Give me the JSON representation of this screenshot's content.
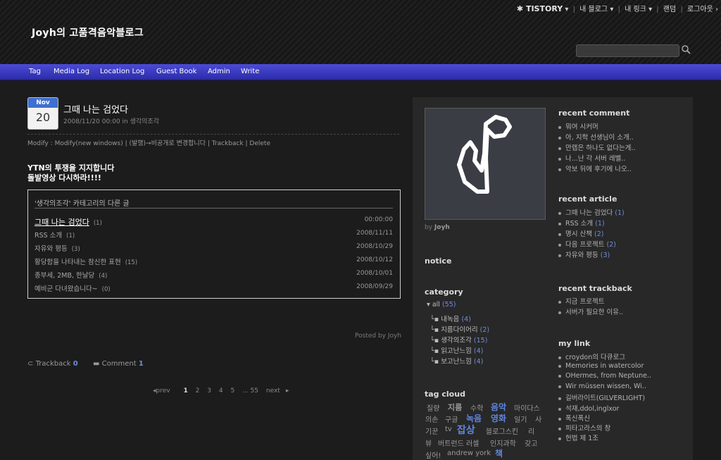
{
  "topbar": {
    "tistory": "TISTORY",
    "my_blog": "내 블로그",
    "my_link": "내 링크",
    "random": "랜덤",
    "logout": "로그아웃"
  },
  "blog_title": "Joyh의 고품격음악블로그",
  "nav": [
    "Tag",
    "Media Log",
    "Location Log",
    "Guest Book",
    "Admin",
    "Write"
  ],
  "post": {
    "month": "Nov",
    "day": "20",
    "title": "그때 나는 검었다",
    "meta": "2008/11/20 00:00 in 생각의조각",
    "modify": "Modify : Modify(new windows) | (발행)→비공개로 변경합니다 | Trackback | Delete",
    "ytn_line1": "YTN의 투쟁을 지지합니다",
    "ytn_line2": "돌발영상 다시하라!!!!",
    "related_title": "'생각의조각' 카테고리의 다른 글",
    "related": [
      {
        "title": "그때 나는 검었다",
        "count": "(1)",
        "date": "00:00:00"
      },
      {
        "title": "RSS 소개",
        "count": "(1)",
        "date": "2008/11/11"
      },
      {
        "title": "자유와 평등",
        "count": "(3)",
        "date": "2008/10/29"
      },
      {
        "title": "황당함을 나타내는 참신한 표현",
        "count": "(15)",
        "date": "2008/10/12"
      },
      {
        "title": "종부세, 2MB, 한날당",
        "count": "(4)",
        "date": "2008/10/01"
      },
      {
        "title": "예비군 다녀왔습니다~",
        "count": "(0)",
        "date": "2008/09/29"
      }
    ],
    "posted_by": "Posted by Joyh",
    "trackback_label": "Trackback",
    "trackback_count": "0",
    "comment_label": "Comment",
    "comment_count": "1",
    "pager": [
      "prev",
      "1",
      "2",
      "3",
      "4",
      "5",
      "... 55",
      "next"
    ]
  },
  "sidebar": {
    "by_label": "by",
    "by_name": "Joyh",
    "notice": "notice",
    "category": "category",
    "cat_all": "all",
    "cat_all_count": "(55)",
    "categories": [
      {
        "name": "내녹음",
        "count": "(4)"
      },
      {
        "name": "지름다이어리",
        "count": "(2)"
      },
      {
        "name": "생각의조각",
        "count": "(15)"
      },
      {
        "name": "읽고난느낌",
        "count": "(4)"
      },
      {
        "name": "보고난느낌",
        "count": "(4)"
      }
    ],
    "tag_cloud": "tag cloud",
    "tags": [
      "질량",
      "지름",
      "수학",
      "음악",
      "마이다스",
      "의손",
      "구글",
      "녹음",
      "영화",
      "일기",
      "사",
      "기꾼",
      "tv",
      "잡상",
      "블로그스킨",
      "리",
      "뷰",
      "버트런드 러셀",
      "인지과학",
      "갖고",
      "싶어!",
      "andrew york",
      "책"
    ],
    "recent_comment": "recent comment",
    "comments": [
      "뭐여 시커머",
      "아, 지학 선생님이 소개..",
      "만렙은 하나도 없다는게..",
      "나...난 각 서버 레벨..",
      "악보 뒤에 후기에 나오.."
    ],
    "recent_article": "recent article",
    "articles": [
      {
        "t": "그때 나는 검었다",
        "n": "(1)"
      },
      {
        "t": "RSS 소개",
        "n": "(1)"
      },
      {
        "t": "명시 산책",
        "n": "(2)"
      },
      {
        "t": "다음 프로젝트",
        "n": "(2)"
      },
      {
        "t": "자유와 평등",
        "n": "(3)"
      }
    ],
    "recent_trackback": "recent trackback",
    "trackbacks": [
      "지금 프로젝트",
      "서버가 필요한 이유.."
    ],
    "my_link": "my link",
    "links": [
      "croydon의 다큐로그",
      "Memories in watercolor",
      "OHermes, from Neptune..",
      "Wir müssen wissen, Wi..",
      "길버라이트(GILVERLIGHT)",
      "석재,ddol,inglxor",
      "폭신폭신",
      "피타고라스의 창",
      "헌법 제 1조"
    ]
  }
}
